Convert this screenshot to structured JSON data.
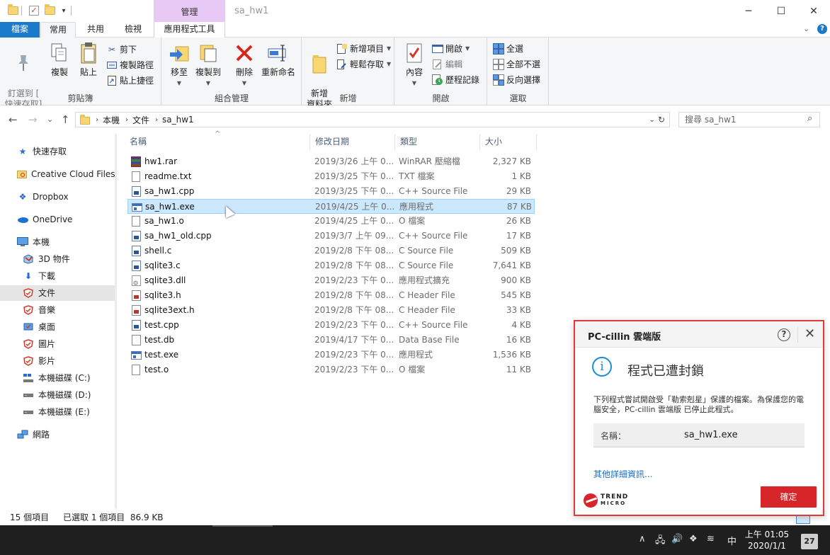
{
  "window": {
    "title": "sa_hw1",
    "manage_tab": "管理",
    "controls": {
      "minimize": "─",
      "maximize": "☐",
      "close": "✕"
    }
  },
  "ribbon_tabs": {
    "file": "檔案",
    "home": "常用",
    "share": "共用",
    "view": "檢視",
    "app_tools": "應用程式工具",
    "expand": "⌄",
    "help": "?"
  },
  "ribbon": {
    "clipboard": {
      "label": "剪貼簿",
      "pin": "釘選到 [\n快速存取]",
      "copy": "複製",
      "paste": "貼上",
      "cut": "剪下",
      "copy_path": "複製路徑",
      "paste_shortcut": "貼上捷徑"
    },
    "organize": {
      "label": "組合管理",
      "move_to": "移至",
      "copy_to": "複製到",
      "delete": "刪除",
      "rename": "重新命名"
    },
    "new": {
      "label": "新增",
      "new_folder": "新增\n資料夾",
      "new_item": "新增項目",
      "easy_access": "輕鬆存取"
    },
    "open": {
      "label": "開啟",
      "properties": "內容",
      "open": "開啟",
      "edit": "編輯",
      "history": "歷程記錄"
    },
    "select": {
      "label": "選取",
      "select_all": "全選",
      "select_none": "全部不選",
      "invert": "反向選擇"
    }
  },
  "address": {
    "back": "←",
    "forward": "→",
    "recent": "⌄",
    "up": "↑",
    "crumbs": [
      "本機",
      "文件",
      "sa_hw1"
    ],
    "search_placeholder": "搜尋 sa_hw1"
  },
  "nav": {
    "quick_access": "快速存取",
    "creative_cloud": "Creative Cloud Files",
    "dropbox": "Dropbox",
    "onedrive": "OneDrive",
    "this_pc": "本機",
    "objects3d": "3D 物件",
    "downloads": "下載",
    "documents": "文件",
    "music": "音樂",
    "desktop": "桌面",
    "pictures": "圖片",
    "videos": "影片",
    "disk_c": "本機磁碟 (C:)",
    "disk_d": "本機磁碟 (D:)",
    "disk_e": "本機磁碟 (E:)",
    "network": "網路"
  },
  "columns": {
    "name": "名稱",
    "date": "修改日期",
    "type": "類型",
    "size": "大小"
  },
  "files": [
    {
      "name": "hw1.rar",
      "date": "2019/3/26 上午 0...",
      "type": "WinRAR 壓縮檔",
      "size": "2,327 KB",
      "icon": "rar"
    },
    {
      "name": "readme.txt",
      "date": "2019/3/25 下午 0...",
      "type": "TXT 檔案",
      "size": "1 KB",
      "icon": "doc"
    },
    {
      "name": "sa_hw1.cpp",
      "date": "2019/3/25 下午 0...",
      "type": "C++ Source File",
      "size": "29 KB",
      "icon": "code"
    },
    {
      "name": "sa_hw1.exe",
      "date": "2019/4/25 上午 0...",
      "type": "應用程式",
      "size": "87 KB",
      "icon": "exe"
    },
    {
      "name": "sa_hw1.o",
      "date": "2019/4/25 上午 0...",
      "type": "O 檔案",
      "size": "26 KB",
      "icon": "doc"
    },
    {
      "name": "sa_hw1_old.cpp",
      "date": "2019/3/7 上午 09...",
      "type": "C++ Source File",
      "size": "17 KB",
      "icon": "code"
    },
    {
      "name": "shell.c",
      "date": "2019/2/8 下午 08...",
      "type": "C Source File",
      "size": "509 KB",
      "icon": "code"
    },
    {
      "name": "sqlite3.c",
      "date": "2019/2/8 下午 08...",
      "type": "C Source File",
      "size": "7,641 KB",
      "icon": "code"
    },
    {
      "name": "sqlite3.dll",
      "date": "2019/2/23 下午 0...",
      "type": "應用程式擴充",
      "size": "900 KB",
      "icon": "dll"
    },
    {
      "name": "sqlite3.h",
      "date": "2019/2/8 下午 08...",
      "type": "C Header File",
      "size": "545 KB",
      "icon": "hred"
    },
    {
      "name": "sqlite3ext.h",
      "date": "2019/2/8 下午 08...",
      "type": "C Header File",
      "size": "33 KB",
      "icon": "hred"
    },
    {
      "name": "test.cpp",
      "date": "2019/2/23 下午 0...",
      "type": "C++ Source File",
      "size": "4 KB",
      "icon": "code"
    },
    {
      "name": "test.db",
      "date": "2019/4/17 下午 0...",
      "type": "Data Base File",
      "size": "16 KB",
      "icon": "db"
    },
    {
      "name": "test.exe",
      "date": "2019/2/23 下午 0...",
      "type": "應用程式",
      "size": "1,536 KB",
      "icon": "exe"
    },
    {
      "name": "test.o",
      "date": "2019/2/23 下午 0...",
      "type": "O 檔案",
      "size": "11 KB",
      "icon": "doc"
    }
  ],
  "selected_index": 3,
  "status": {
    "count": "15 個項目",
    "selected": "已選取 1 個項目  86.9 KB"
  },
  "taskbar": {
    "tray_up": "∧",
    "ime": "中",
    "time": "上午 01:05",
    "date": "2020/1/1",
    "notifications": "27"
  },
  "dialog": {
    "title": "PC-cillin 雲端版",
    "help": "?",
    "close": "✕",
    "info_glyph": "i",
    "heading": "程式已遭封鎖",
    "message": "下列程式嘗試開啟受「勒索剋星」保護的檔案。為保護您的電腦安全，PC-cillin 雲端版 已停止此程式。",
    "name_label": "名稱：",
    "name_value": "sa_hw1.exe",
    "more": "其他詳細資訊...",
    "brand_line1": "TREND",
    "brand_line2": "MICRO",
    "ok": "確定"
  },
  "colors": {
    "accent": "#1979ca",
    "manage_tab": "#e8c8f4",
    "selection": "#cce8ff",
    "dialog_border": "#e23a3a",
    "dialog_button": "#d7262a",
    "link": "#1a6fc4"
  }
}
